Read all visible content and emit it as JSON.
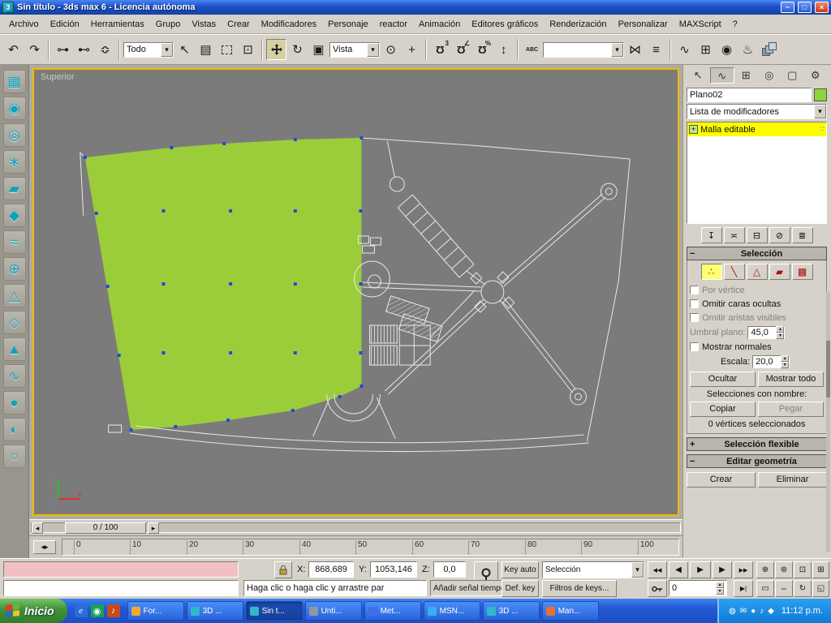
{
  "window": {
    "title": "Sin título - 3ds max 6 - Licencia autónoma"
  },
  "menu": {
    "items": [
      "Archivo",
      "Edición",
      "Herramientas",
      "Grupo",
      "Vistas",
      "Crear",
      "Modificadores",
      "Personaje",
      "reactor",
      "Animación",
      "Editores gráficos",
      "Renderización",
      "Personalizar",
      "MAXScript",
      "?"
    ]
  },
  "toolbar": {
    "selection_filter": "Todo",
    "coord_system": "Vista",
    "named_selection": ""
  },
  "viewport": {
    "label": "Superior",
    "axis_x": "x",
    "axis_y": "y",
    "axis_z": "z"
  },
  "timeline": {
    "slider": "0 / 100",
    "ticks": [
      "0",
      "10",
      "20",
      "30",
      "40",
      "50",
      "60",
      "70",
      "80",
      "90",
      "100"
    ]
  },
  "panel": {
    "object_name": "Plano02",
    "modifier_list": "Lista de modificadores",
    "stack_item": "Malla editable",
    "selection_rollout": "Selección",
    "por_vertice": "Por vértice",
    "omitir_caras": "Omitir caras ocultas",
    "omitir_aristas": "Omitir aristas visibles",
    "umbral_label": "Umbral plano:",
    "umbral_value": "45,0",
    "mostrar_normales": "Mostrar normales",
    "escala_label": "Escala:",
    "escala_value": "20,0",
    "ocultar": "Ocultar",
    "mostrar_todo": "Mostrar todo",
    "selecciones_label": "Selecciones con nombre:",
    "copiar": "Copiar",
    "pegar": "Pegar",
    "status": "0 vértices seleccionados",
    "soft_selection": "Selección flexible",
    "edit_geometry": "Editar geometría",
    "crear": "Crear",
    "eliminar": "Eliminar"
  },
  "status": {
    "x_label": "X:",
    "x": "868,689",
    "y_label": "Y:",
    "y": "1053,146",
    "z_label": "Z:",
    "z": "0,0",
    "prompt": "Haga clic o haga clic y arrastre par",
    "time_tag": "Añadir señal tiempo",
    "key_auto": "Key auto",
    "def_key": "Def. key",
    "key_filters": "Filtros de keys...",
    "key_selection": "Selección",
    "frame": "0"
  },
  "taskbar": {
    "start": "Inicio",
    "buttons": [
      "For...",
      "3D ...",
      "Sin t...",
      "Unti...",
      "Met...",
      "MSN...",
      "3D ...",
      "Man..."
    ],
    "icon_colors": [
      "#f0a830",
      "#30b8c8",
      "#30b8c8",
      "#9098a0",
      "#4070e8",
      "#38b0f0",
      "#30b8c8",
      "#e87030"
    ],
    "clock": "11:12 p.m."
  },
  "colors": {
    "viewport_border": "#eebb00",
    "mesh_green": "#9bcd3a",
    "stack_highlight": "#fdfd00",
    "object_swatch": "#8ed53a"
  },
  "icons": {
    "app": "3",
    "minimize": "−",
    "maximize": "□",
    "close": "×",
    "undo": "↶",
    "redo": "↷",
    "link": "⊶",
    "unlink": "⊷",
    "bind": "≎",
    "select": "↖",
    "select_by_name": "▤",
    "window_crossing": "⊡",
    "rotate": "↻",
    "scale": "▣",
    "pivot": "⊙",
    "manipulate": "+",
    "magnet": "Ω",
    "snap_count": "3",
    "angle": "∠",
    "percent": "%",
    "spinner_snap": "↕",
    "named_sets": "ABC",
    "mirror": "⋈",
    "align": "≡",
    "curve_editor": "∿",
    "schematic": "⊞",
    "material": "◉",
    "render": "♨",
    "combo_arrow": "▾",
    "expand": "+",
    "collapse": "−",
    "spin_up": "▴",
    "spin_down": "▾",
    "tab_create": "↖",
    "tab_modify": "∿",
    "tab_hierarchy": "⊞",
    "tab_motion": "◎",
    "tab_display": "▢",
    "tab_utilities": "⚙",
    "subobj_vertex": "∴",
    "subobj_edge": "╲",
    "subobj_face": "△",
    "subobj_poly": "▰",
    "subobj_element": "▩",
    "stack_dots": "∵",
    "pin_stack": "↧",
    "show_end": "≍",
    "make_unique": "⊟",
    "remove_mod": "⊘",
    "configure": "≣",
    "slider_left": "◂",
    "slider_right": "▸",
    "trackbar_btn": "◂▸",
    "go_start": "◀◀",
    "prev_frame": "◀",
    "play": "▶",
    "next_frame": "▶",
    "go_end": "▶▶",
    "end_frame": "▶|",
    "zoom": "⊕",
    "zoom_all": "⊛",
    "zoom_extents": "⊡",
    "zoom_extents_all": "⊞",
    "zoom_region": "▭",
    "pan": "⇔",
    "arc_rotate": "↻",
    "min_max": "◱",
    "reactor": [
      "▦",
      "◉",
      "◎",
      "∗",
      "▰",
      "◆",
      "≈",
      "⊕",
      "△",
      "◇",
      "▲",
      "∿",
      "●",
      "◐",
      "○"
    ],
    "quicklaunch": [
      "e",
      "◉",
      "♪"
    ],
    "tray": [
      "◍",
      "✉",
      "●",
      "♪",
      "◆"
    ]
  }
}
